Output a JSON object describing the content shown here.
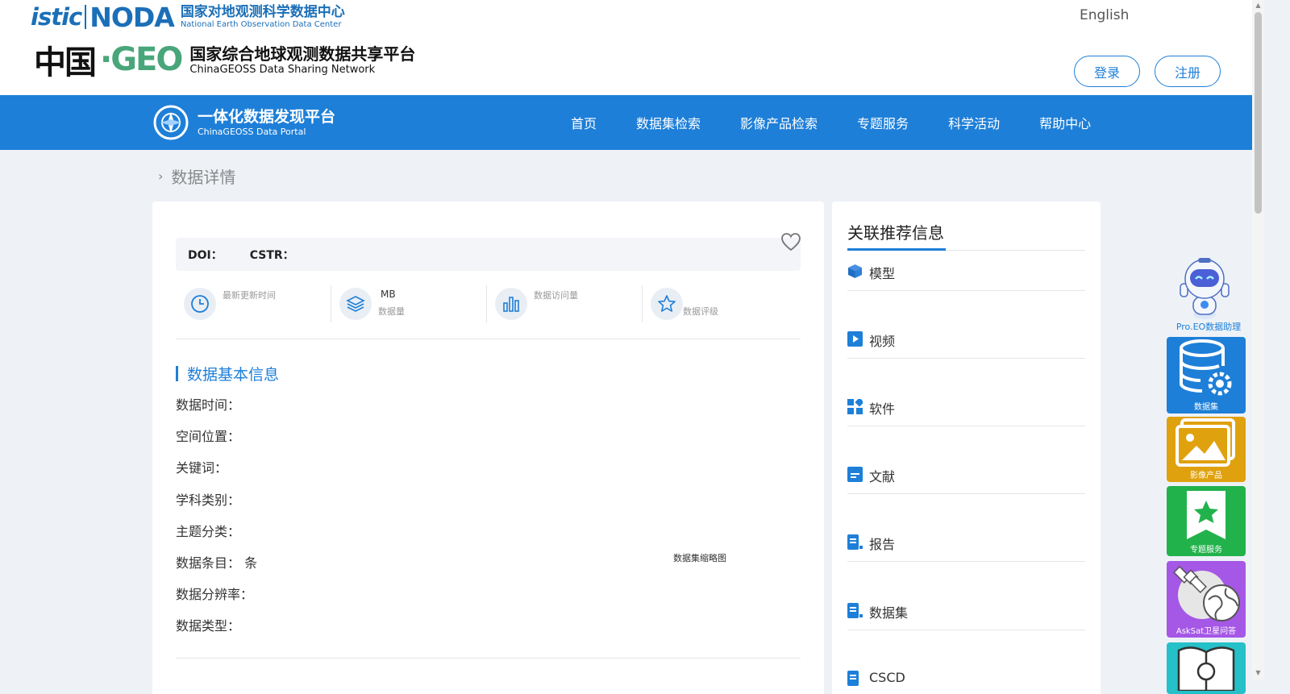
{
  "header": {
    "istic_logo_text": "istic",
    "noda_logo_text": "NODA",
    "noda_cn": "国家对地观测科学数据中心",
    "noda_en": "National Earth Observation Data Center",
    "china_cn": "中国",
    "geo_text": "GEO",
    "geoss_cn": "国家综合地球观测数据共享平台",
    "geoss_en": "ChinaGEOSS Data Sharing Network",
    "language_link": "English",
    "login_label": "登录",
    "register_label": "注册"
  },
  "nav": {
    "portal_cn": "一体化数据发现平台",
    "portal_en": "ChinaGEOSS Data Portal",
    "items": [
      {
        "label": "首页"
      },
      {
        "label": "数据集检索"
      },
      {
        "label": "影像产品检索"
      },
      {
        "label": "专题服务"
      },
      {
        "label": "科学活动"
      },
      {
        "label": "帮助中心"
      }
    ]
  },
  "breadcrumb": {
    "label": "数据详情"
  },
  "detail": {
    "doi_label": "DOI：",
    "cstr_label": "CSTR：",
    "stats": [
      {
        "icon": "clock-icon",
        "value": "",
        "label": "最新更新时间"
      },
      {
        "icon": "layers-icon",
        "value": "MB",
        "label": "数据量"
      },
      {
        "icon": "bar-chart-icon",
        "value": "",
        "label": "数据访问量"
      },
      {
        "icon": "star-icon",
        "value": "",
        "label": "数据评级"
      }
    ],
    "section_title": "数据基本信息",
    "fields": [
      {
        "label": "数据时间："
      },
      {
        "label": "空间位置："
      },
      {
        "label": "关键词："
      },
      {
        "label": "学科类别："
      },
      {
        "label": "主题分类："
      },
      {
        "label": "数据条目： 条"
      },
      {
        "label": "数据分辨率："
      },
      {
        "label": "数据类型："
      }
    ],
    "thumbnail_alt": "数据集缩略图"
  },
  "sidebar": {
    "title": "关联推荐信息",
    "items": [
      {
        "label": "模型",
        "icon": "cube-icon"
      },
      {
        "label": "视频",
        "icon": "play-icon"
      },
      {
        "label": "软件",
        "icon": "grid-icon"
      },
      {
        "label": "文献",
        "icon": "document-icon"
      },
      {
        "label": "报告",
        "icon": "report-icon"
      },
      {
        "label": "数据集",
        "icon": "report-icon"
      },
      {
        "label": "CSCD",
        "icon": "report-icon"
      }
    ]
  },
  "tools": {
    "assistant_label": "Pro.EO数据助理",
    "dataset_label": "数据集",
    "image_label": "影像产品",
    "topic_label": "专题服务",
    "asksat_label": "AskSat卫星问答"
  },
  "colors": {
    "primary": "#1e7fd8",
    "image_tool": "#e0a10f",
    "topic_tool": "#22b24c",
    "asksat_tool": "#a557e6",
    "next_tool": "#25c0c8"
  }
}
